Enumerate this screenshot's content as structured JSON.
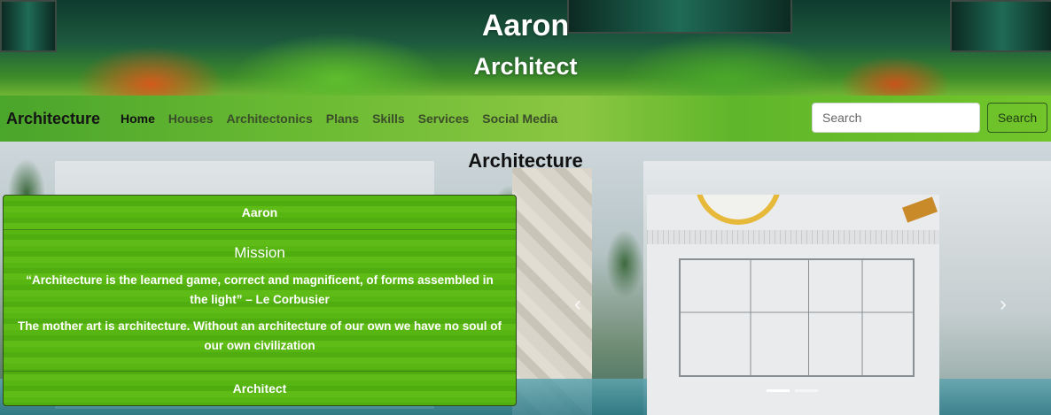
{
  "hero": {
    "title": "Aaron",
    "subtitle": "Architect"
  },
  "nav": {
    "brand": "Architecture",
    "links": [
      {
        "label": "Home",
        "active": true
      },
      {
        "label": "Houses"
      },
      {
        "label": "Architectonics"
      },
      {
        "label": "Plans"
      },
      {
        "label": "Skills"
      },
      {
        "label": "Services"
      },
      {
        "label": "Social Media"
      }
    ],
    "search": {
      "placeholder": "Search",
      "button_label": "Search"
    }
  },
  "main": {
    "heading": "Architecture",
    "card": {
      "header": "Aaron",
      "title": "Mission",
      "quote": "“Architecture is the learned game, correct and magnificent, of forms assembled in the light” – Le Corbusier",
      "text": "The mother art is architecture. Without an architecture of our own we have no soul of our own civilization",
      "footer": "Architect"
    },
    "carousel": {
      "slide_count": 2,
      "active_index": 0
    }
  }
}
